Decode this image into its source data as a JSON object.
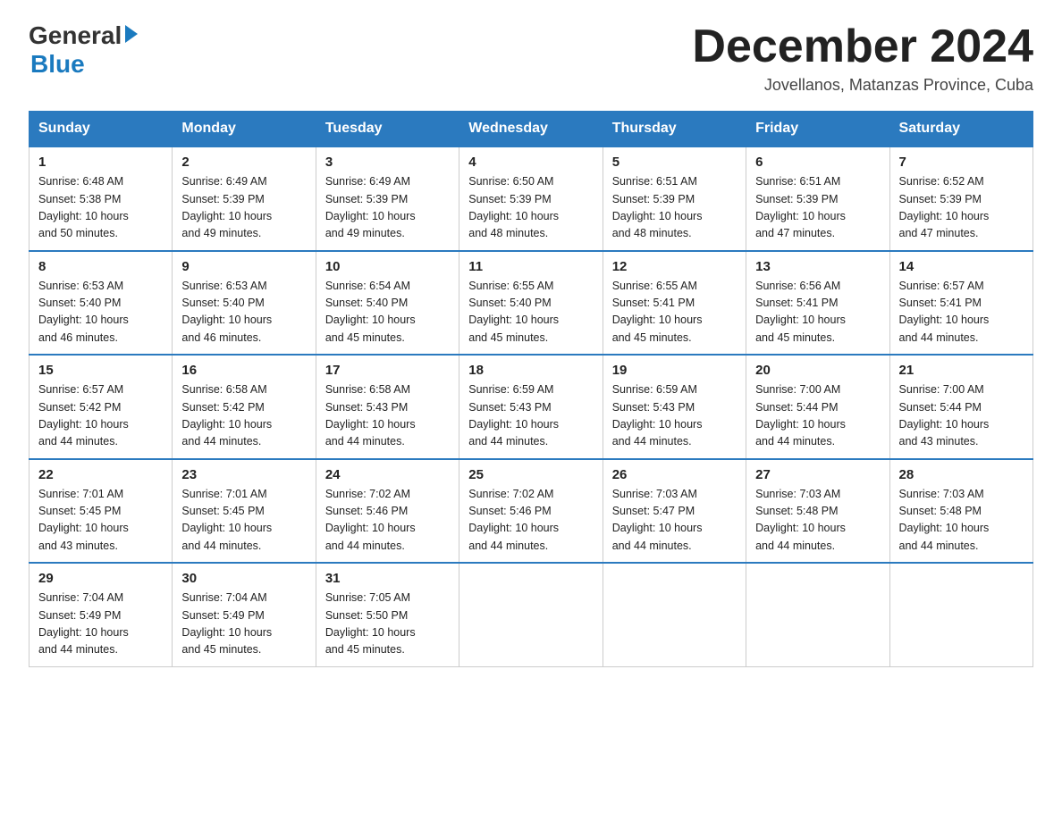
{
  "logo": {
    "general": "General",
    "blue": "Blue"
  },
  "title": "December 2024",
  "subtitle": "Jovellanos, Matanzas Province, Cuba",
  "headers": [
    "Sunday",
    "Monday",
    "Tuesday",
    "Wednesday",
    "Thursday",
    "Friday",
    "Saturday"
  ],
  "weeks": [
    [
      {
        "day": "1",
        "sunrise": "6:48 AM",
        "sunset": "5:38 PM",
        "daylight": "10 hours and 50 minutes."
      },
      {
        "day": "2",
        "sunrise": "6:49 AM",
        "sunset": "5:39 PM",
        "daylight": "10 hours and 49 minutes."
      },
      {
        "day": "3",
        "sunrise": "6:49 AM",
        "sunset": "5:39 PM",
        "daylight": "10 hours and 49 minutes."
      },
      {
        "day": "4",
        "sunrise": "6:50 AM",
        "sunset": "5:39 PM",
        "daylight": "10 hours and 48 minutes."
      },
      {
        "day": "5",
        "sunrise": "6:51 AM",
        "sunset": "5:39 PM",
        "daylight": "10 hours and 48 minutes."
      },
      {
        "day": "6",
        "sunrise": "6:51 AM",
        "sunset": "5:39 PM",
        "daylight": "10 hours and 47 minutes."
      },
      {
        "day": "7",
        "sunrise": "6:52 AM",
        "sunset": "5:39 PM",
        "daylight": "10 hours and 47 minutes."
      }
    ],
    [
      {
        "day": "8",
        "sunrise": "6:53 AM",
        "sunset": "5:40 PM",
        "daylight": "10 hours and 46 minutes."
      },
      {
        "day": "9",
        "sunrise": "6:53 AM",
        "sunset": "5:40 PM",
        "daylight": "10 hours and 46 minutes."
      },
      {
        "day": "10",
        "sunrise": "6:54 AM",
        "sunset": "5:40 PM",
        "daylight": "10 hours and 45 minutes."
      },
      {
        "day": "11",
        "sunrise": "6:55 AM",
        "sunset": "5:40 PM",
        "daylight": "10 hours and 45 minutes."
      },
      {
        "day": "12",
        "sunrise": "6:55 AM",
        "sunset": "5:41 PM",
        "daylight": "10 hours and 45 minutes."
      },
      {
        "day": "13",
        "sunrise": "6:56 AM",
        "sunset": "5:41 PM",
        "daylight": "10 hours and 45 minutes."
      },
      {
        "day": "14",
        "sunrise": "6:57 AM",
        "sunset": "5:41 PM",
        "daylight": "10 hours and 44 minutes."
      }
    ],
    [
      {
        "day": "15",
        "sunrise": "6:57 AM",
        "sunset": "5:42 PM",
        "daylight": "10 hours and 44 minutes."
      },
      {
        "day": "16",
        "sunrise": "6:58 AM",
        "sunset": "5:42 PM",
        "daylight": "10 hours and 44 minutes."
      },
      {
        "day": "17",
        "sunrise": "6:58 AM",
        "sunset": "5:43 PM",
        "daylight": "10 hours and 44 minutes."
      },
      {
        "day": "18",
        "sunrise": "6:59 AM",
        "sunset": "5:43 PM",
        "daylight": "10 hours and 44 minutes."
      },
      {
        "day": "19",
        "sunrise": "6:59 AM",
        "sunset": "5:43 PM",
        "daylight": "10 hours and 44 minutes."
      },
      {
        "day": "20",
        "sunrise": "7:00 AM",
        "sunset": "5:44 PM",
        "daylight": "10 hours and 44 minutes."
      },
      {
        "day": "21",
        "sunrise": "7:00 AM",
        "sunset": "5:44 PM",
        "daylight": "10 hours and 43 minutes."
      }
    ],
    [
      {
        "day": "22",
        "sunrise": "7:01 AM",
        "sunset": "5:45 PM",
        "daylight": "10 hours and 43 minutes."
      },
      {
        "day": "23",
        "sunrise": "7:01 AM",
        "sunset": "5:45 PM",
        "daylight": "10 hours and 44 minutes."
      },
      {
        "day": "24",
        "sunrise": "7:02 AM",
        "sunset": "5:46 PM",
        "daylight": "10 hours and 44 minutes."
      },
      {
        "day": "25",
        "sunrise": "7:02 AM",
        "sunset": "5:46 PM",
        "daylight": "10 hours and 44 minutes."
      },
      {
        "day": "26",
        "sunrise": "7:03 AM",
        "sunset": "5:47 PM",
        "daylight": "10 hours and 44 minutes."
      },
      {
        "day": "27",
        "sunrise": "7:03 AM",
        "sunset": "5:48 PM",
        "daylight": "10 hours and 44 minutes."
      },
      {
        "day": "28",
        "sunrise": "7:03 AM",
        "sunset": "5:48 PM",
        "daylight": "10 hours and 44 minutes."
      }
    ],
    [
      {
        "day": "29",
        "sunrise": "7:04 AM",
        "sunset": "5:49 PM",
        "daylight": "10 hours and 44 minutes."
      },
      {
        "day": "30",
        "sunrise": "7:04 AM",
        "sunset": "5:49 PM",
        "daylight": "10 hours and 45 minutes."
      },
      {
        "day": "31",
        "sunrise": "7:05 AM",
        "sunset": "5:50 PM",
        "daylight": "10 hours and 45 minutes."
      },
      null,
      null,
      null,
      null
    ]
  ],
  "sunrise_label": "Sunrise:",
  "sunset_label": "Sunset:",
  "daylight_label": "Daylight:"
}
